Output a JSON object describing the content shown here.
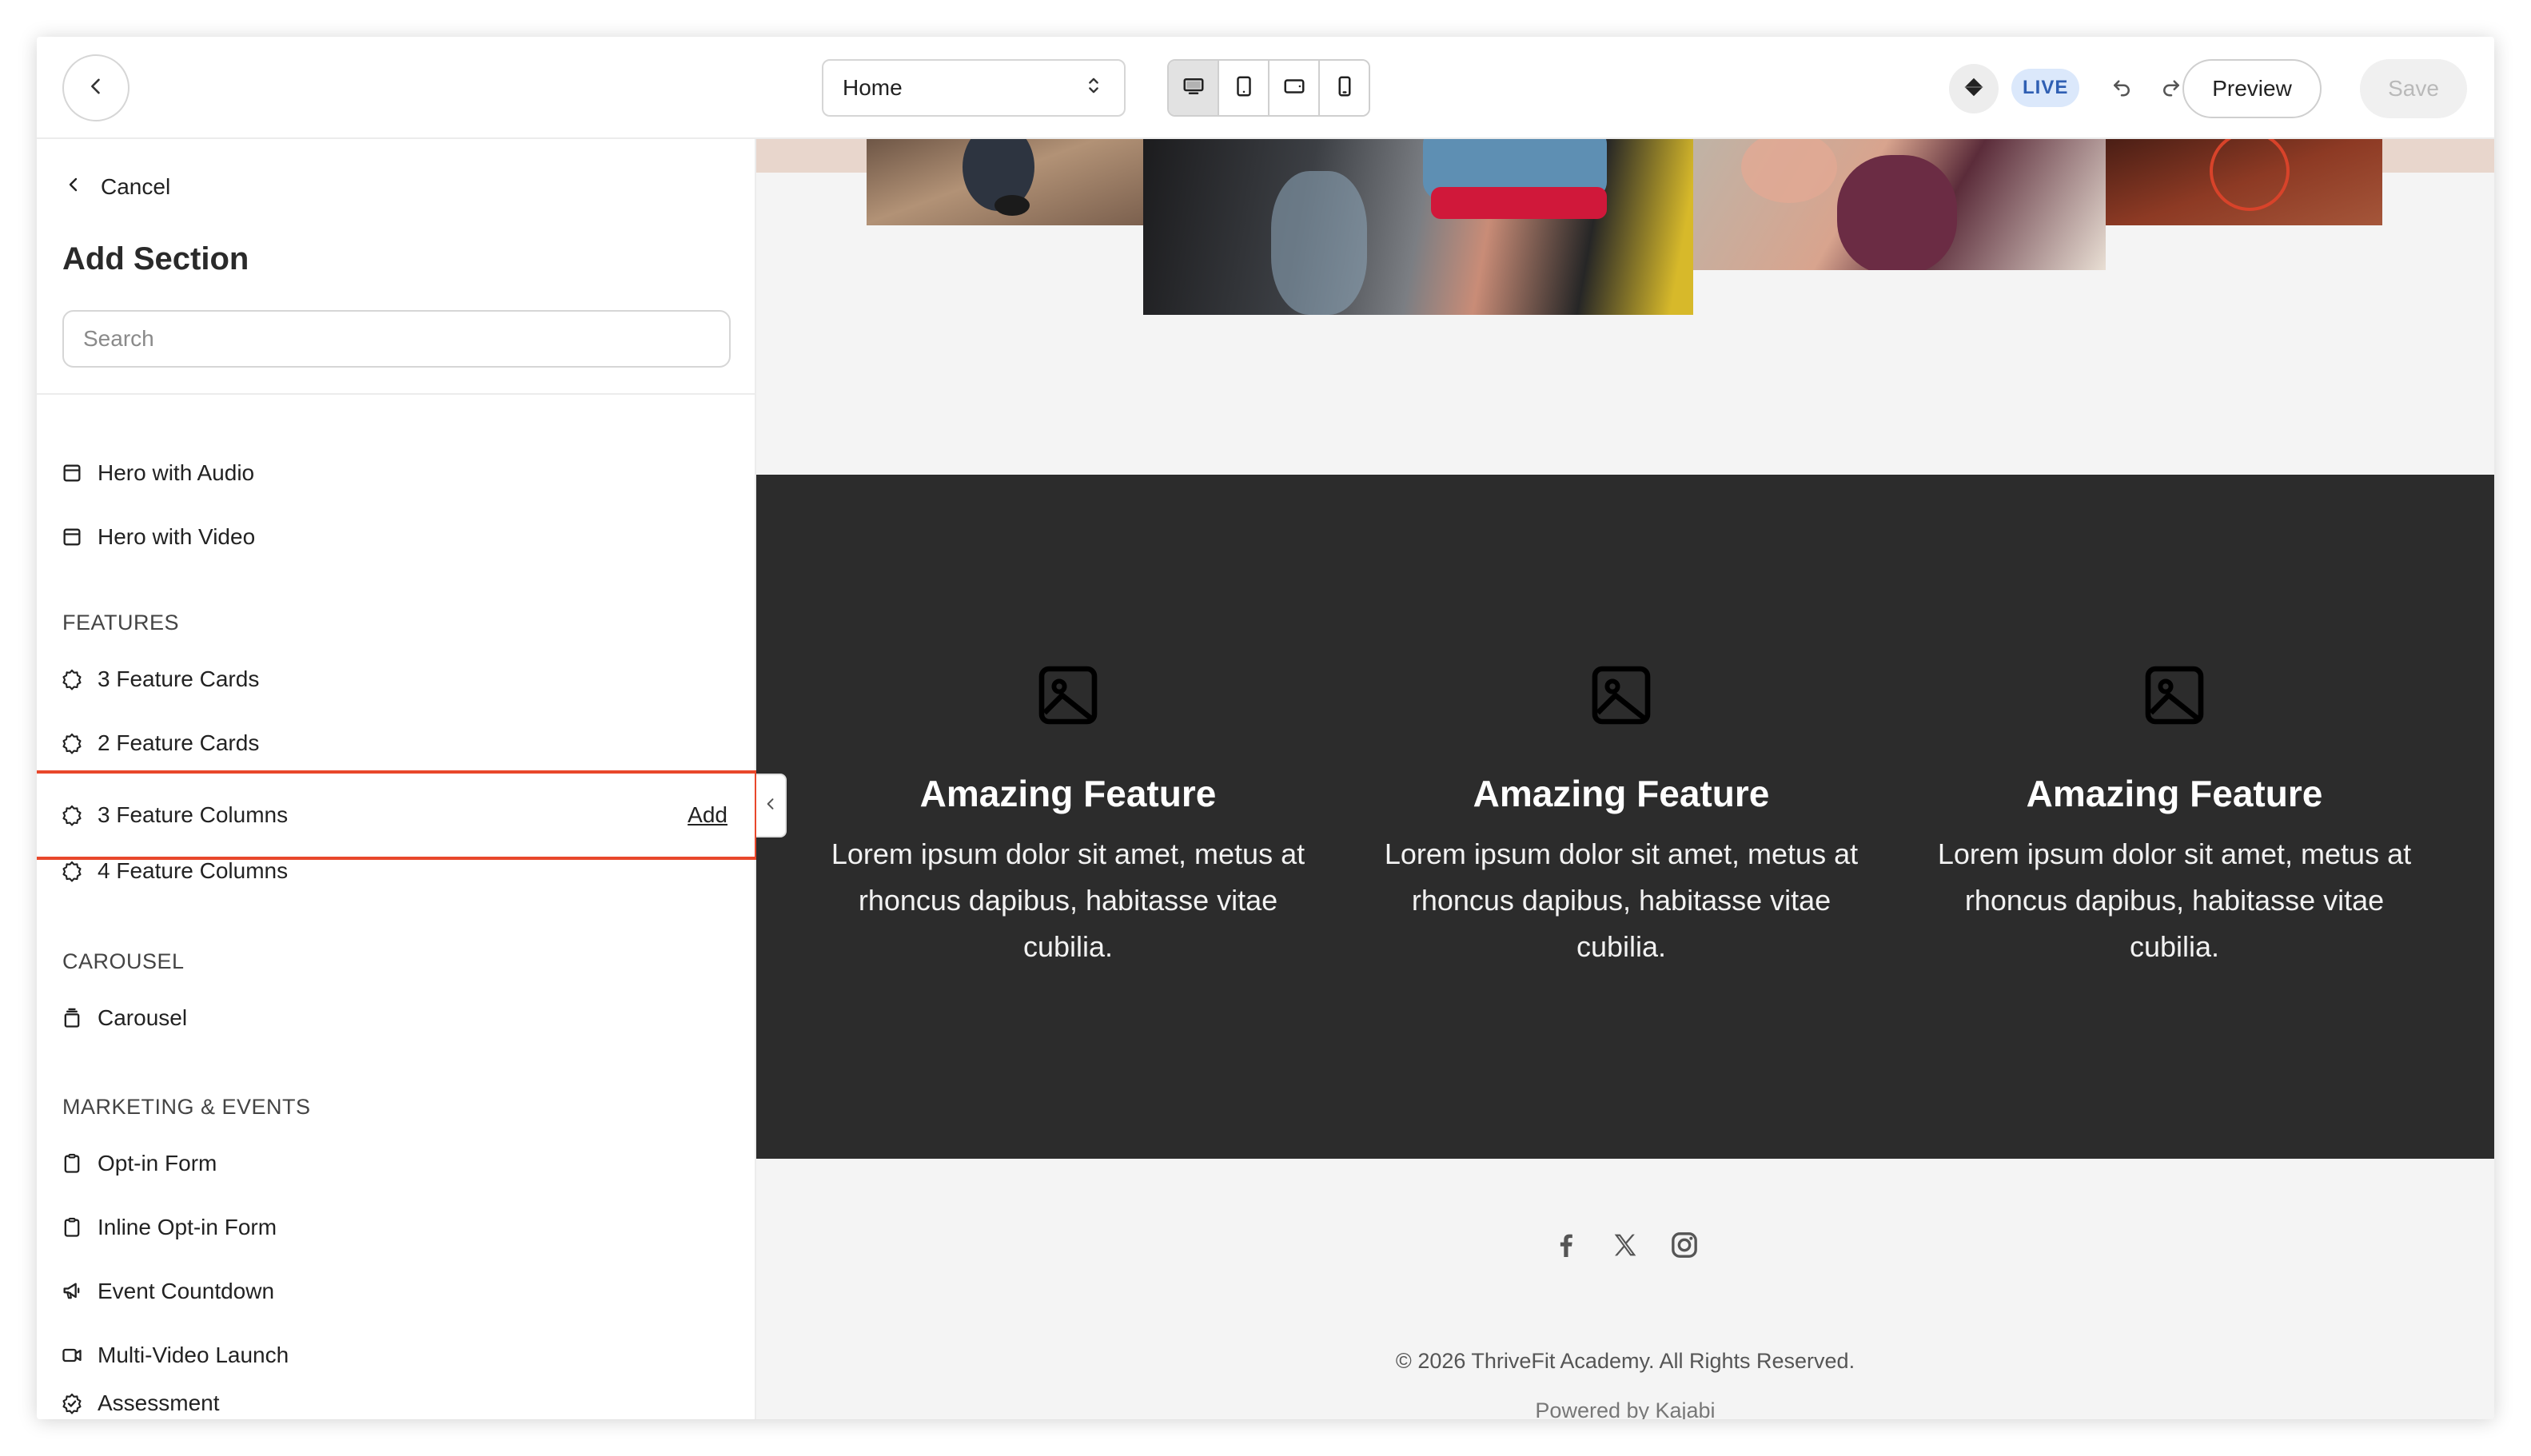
{
  "topbar": {
    "page_select": {
      "value": "Home"
    },
    "devices": [
      "desktop",
      "tablet-portrait",
      "tablet-landscape",
      "mobile"
    ],
    "active_device": "desktop",
    "live_label": "LIVE",
    "preview_label": "Preview",
    "save_label": "Save"
  },
  "sidebar": {
    "cancel_label": "Cancel",
    "title": "Add Section",
    "search_placeholder": "Search",
    "items": {
      "hero_audio": "Hero with Audio",
      "hero_video": "Hero with Video",
      "features_heading": "FEATURES",
      "feature_cards_3": "3 Feature Cards",
      "feature_cards_2": "2 Feature Cards",
      "feature_columns_3": "3 Feature Columns",
      "add_label": "Add",
      "feature_columns_4": "4 Feature Columns",
      "carousel_heading": "CAROUSEL",
      "carousel": "Carousel",
      "marketing_heading": "MARKETING & EVENTS",
      "optin_form": "Opt-in Form",
      "inline_optin_form": "Inline Opt-in Form",
      "event_countdown": "Event Countdown",
      "multi_video_launch": "Multi-Video Launch",
      "assessment": "Assessment"
    }
  },
  "canvas": {
    "features": [
      {
        "title": "Amazing Feature",
        "body": "Lorem ipsum dolor sit amet, metus at rhoncus dapibus, habitasse vitae cubilia."
      },
      {
        "title": "Amazing Feature",
        "body": "Lorem ipsum dolor sit amet, metus at rhoncus dapibus, habitasse vitae cubilia."
      },
      {
        "title": "Amazing Feature",
        "body": "Lorem ipsum dolor sit amet, metus at rhoncus dapibus, habitasse vitae cubilia."
      }
    ],
    "social": [
      "facebook-icon",
      "x-icon",
      "instagram-icon"
    ],
    "copyright": "© 2026 ThriveFit Academy. All Rights Reserved.",
    "powered_by": "Powered by Kajabi"
  },
  "colors": {
    "highlight": "#e8472b",
    "live_bg": "#dbe8fb",
    "features_bg": "#2c2c2c"
  }
}
